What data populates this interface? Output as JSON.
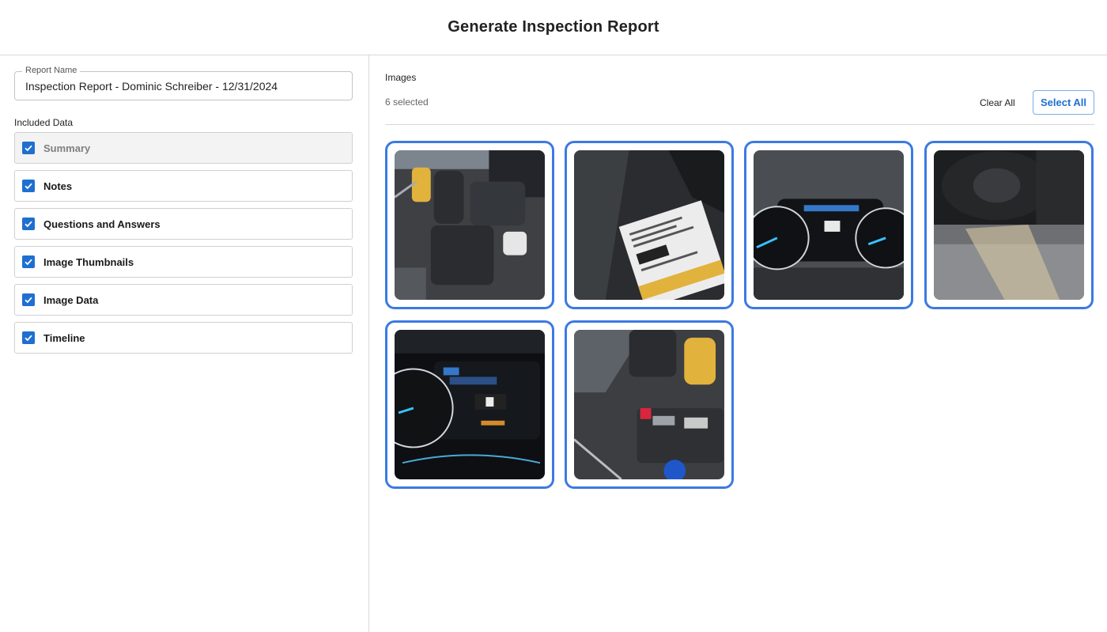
{
  "header": {
    "title": "Generate Inspection Report"
  },
  "report_name": {
    "label": "Report Name",
    "value": "Inspection Report - Dominic Schreiber - 12/31/2024"
  },
  "included": {
    "heading": "Included Data",
    "items": [
      {
        "label": "Summary",
        "checked": true,
        "disabled": true
      },
      {
        "label": "Notes",
        "checked": true
      },
      {
        "label": "Questions and Answers",
        "checked": true
      },
      {
        "label": "Image Thumbnails",
        "checked": true
      },
      {
        "label": "Image Data",
        "checked": true
      },
      {
        "label": "Timeline",
        "checked": true
      }
    ]
  },
  "images": {
    "heading": "Images",
    "count_text": "6 selected",
    "clear_all": "Clear All",
    "select_all": "Select All",
    "accent": "#3b7ae3",
    "tiles": [
      {
        "subject": "engine-bay",
        "selected": true
      },
      {
        "subject": "door-label-sticker",
        "selected": true
      },
      {
        "subject": "instrument-cluster",
        "selected": true
      },
      {
        "subject": "spare-tire-underside",
        "selected": true
      },
      {
        "subject": "instrument-cluster-closeup",
        "selected": true
      },
      {
        "subject": "engine-battery",
        "selected": true
      }
    ]
  }
}
